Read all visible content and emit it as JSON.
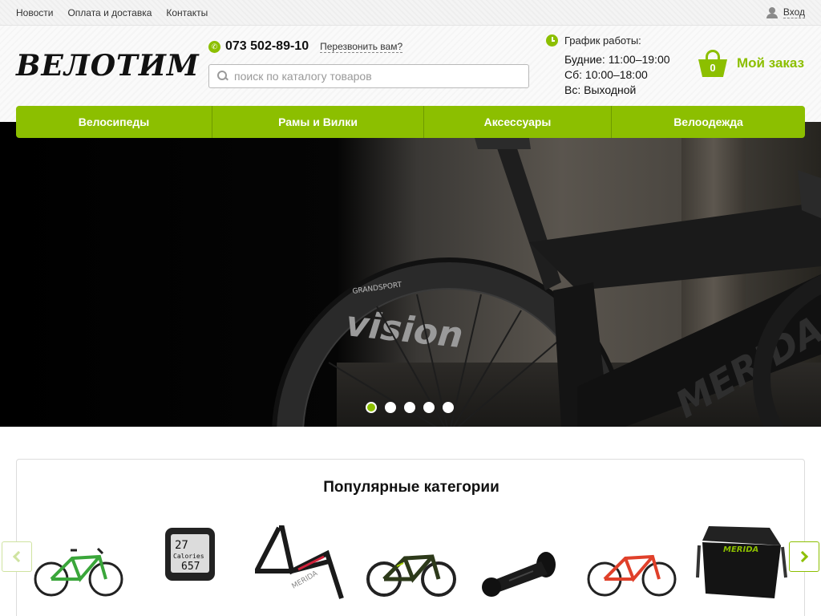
{
  "topbar": {
    "links": [
      "Новости",
      "Оплата и доставка",
      "Контакты"
    ],
    "login": "Вход"
  },
  "header": {
    "logo": "ВЕЛОТИМ",
    "phone": "073 502-89-10",
    "callback": "Перезвонить вам?",
    "search_placeholder": "поиск по каталогу товаров",
    "schedule_title": "График работы:",
    "schedule_lines": [
      "Будние: 11:00–19:00",
      "Сб: 10:00–18:00",
      "Вс: Выходной"
    ],
    "cart_count": "0",
    "cart_label": "Мой заказ"
  },
  "nav": [
    "Велосипеды",
    "Рамы и Вилки",
    "Аксессуары",
    "Велоодежда"
  ],
  "slider": {
    "tire_text": "GRANDSPORT",
    "rim_text": "vision",
    "frame_text": "MERIDA",
    "slides": 5,
    "active_slide": 1
  },
  "categories": {
    "title": "Популярные категории",
    "computer_screen": [
      "27",
      "Calories",
      "657"
    ],
    "frame_brand": "MERIDA",
    "bag_brand": "MERIDA",
    "items": [
      {
        "icon": "green-mountain-bike-icon",
        "color": "#3aa63a"
      },
      {
        "icon": "bike-computer-icon",
        "color": "#222222"
      },
      {
        "icon": "bike-frame-icon",
        "color": "#1a1a1a"
      },
      {
        "icon": "dark-mountain-bike-icon",
        "color": "#2d3a1a"
      },
      {
        "icon": "stem-icon",
        "color": "#111111"
      },
      {
        "icon": "red-mountain-bike-icon",
        "color": "#e0402a"
      },
      {
        "icon": "messenger-bag-icon",
        "color": "#111111"
      }
    ]
  },
  "colors": {
    "accent": "#8cbf00",
    "nav_divider": "#6e9a00"
  }
}
